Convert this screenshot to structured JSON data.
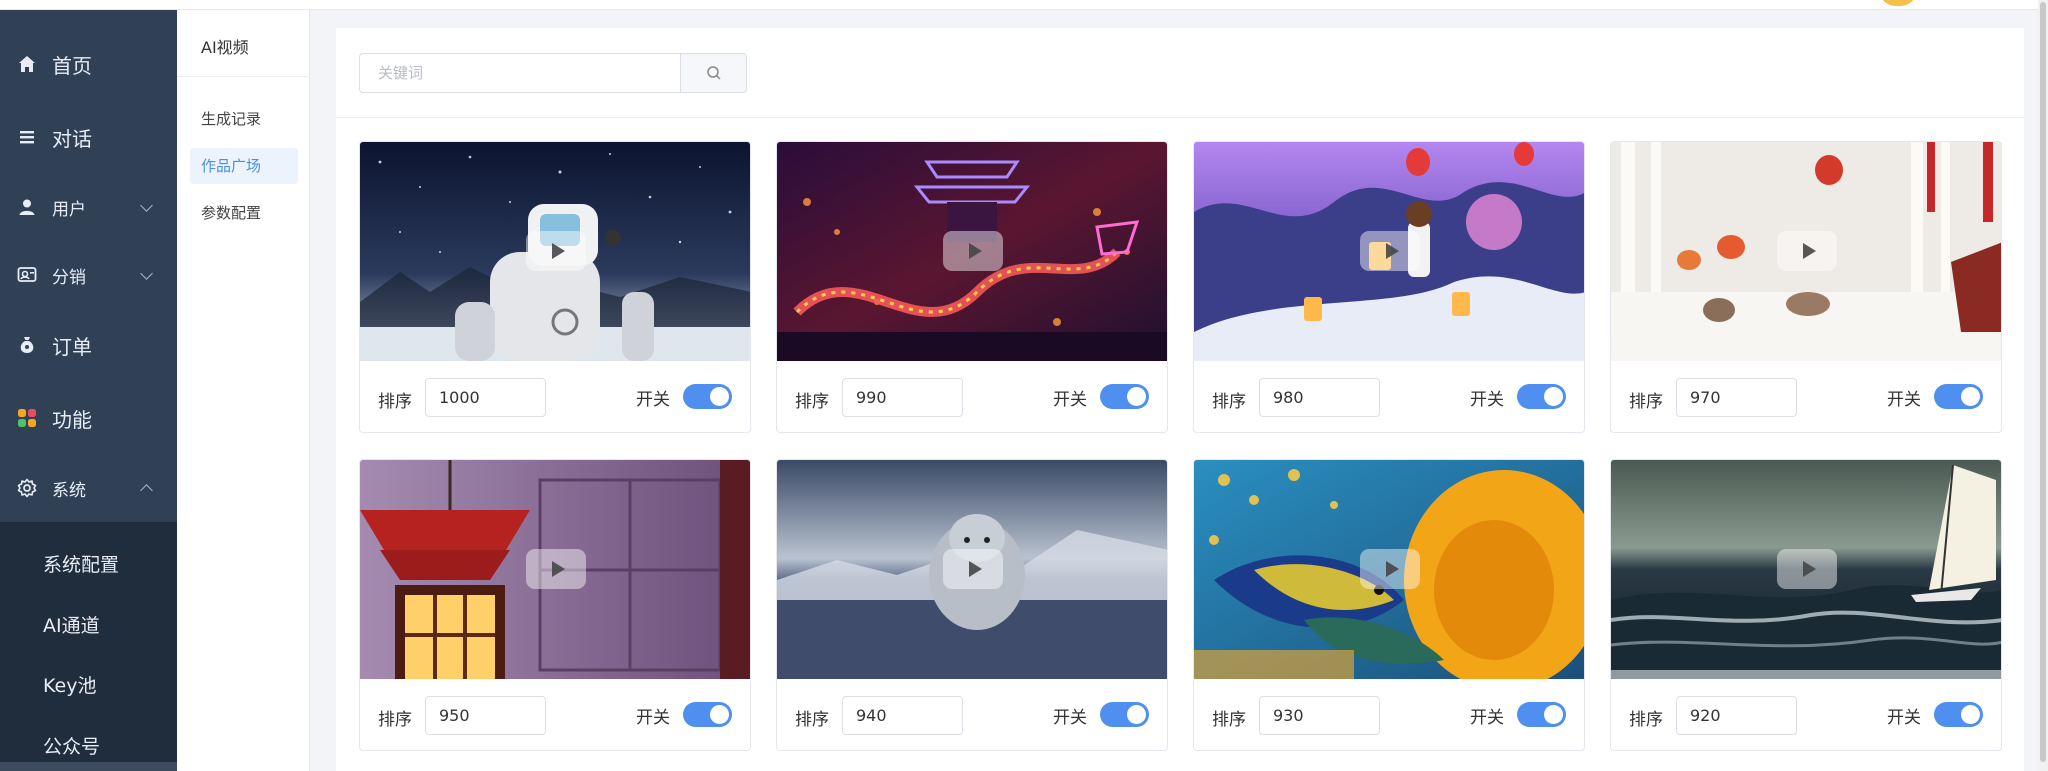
{
  "sidebar": {
    "items": [
      {
        "label": "首页",
        "icon": "home-icon"
      },
      {
        "label": "对话",
        "icon": "list-icon"
      },
      {
        "label": "用户",
        "icon": "user-icon"
      },
      {
        "label": "分销",
        "icon": "distribution-icon"
      },
      {
        "label": "订单",
        "icon": "money-bag-icon"
      },
      {
        "label": "功能",
        "icon": "apps-grid-icon"
      },
      {
        "label": "系统",
        "icon": "gear-icon"
      }
    ],
    "system_submenu": [
      "系统配置",
      "AI通道",
      "Key池",
      "公众号"
    ]
  },
  "subnav": {
    "title": "AI视频",
    "links": [
      "生成记录",
      "作品广场",
      "参数配置"
    ],
    "active": "作品广场"
  },
  "search": {
    "placeholder": "关键词",
    "value": ""
  },
  "cards": [
    {
      "sort_label": "排序",
      "sort_value": "1000",
      "switch_label": "开关",
      "enabled": true,
      "scene": "snow-robot"
    },
    {
      "sort_label": "排序",
      "sort_value": "990",
      "switch_label": "开关",
      "enabled": true,
      "scene": "neon-dragon"
    },
    {
      "sort_label": "排序",
      "sort_value": "980",
      "switch_label": "开关",
      "enabled": true,
      "scene": "purple-lanterns"
    },
    {
      "sort_label": "排序",
      "sort_value": "970",
      "switch_label": "开关",
      "enabled": true,
      "scene": "snowy-forest"
    },
    {
      "sort_label": "排序",
      "sort_value": "950",
      "switch_label": "开关",
      "enabled": true,
      "scene": "red-lantern"
    },
    {
      "sort_label": "排序",
      "sort_value": "940",
      "switch_label": "开关",
      "enabled": true,
      "scene": "polar-bear"
    },
    {
      "sort_label": "排序",
      "sort_value": "930",
      "switch_label": "开关",
      "enabled": true,
      "scene": "coral-fish"
    },
    {
      "sort_label": "排序",
      "sort_value": "920",
      "switch_label": "开关",
      "enabled": true,
      "scene": "windsurf"
    }
  ],
  "colors": {
    "sidebar_bg": "#304156",
    "submenu_bg": "#1f2d3d",
    "accent": "#4f8ff0",
    "active_link": "#4a90e2"
  }
}
